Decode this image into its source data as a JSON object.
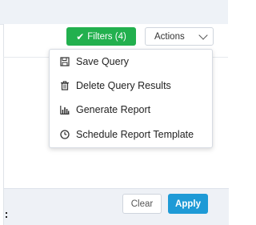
{
  "toolbar": {
    "filters_label": "Filters (4)",
    "actions_label": "Actions"
  },
  "actions_menu": {
    "items": [
      {
        "label": "Save Query",
        "icon": "save-icon"
      },
      {
        "label": "Delete Query Results",
        "icon": "trash-icon"
      },
      {
        "label": "Generate Report",
        "icon": "bar-chart-icon"
      },
      {
        "label": "Schedule Report Template",
        "icon": "clock-icon"
      }
    ]
  },
  "footer": {
    "clear_label": "Clear",
    "apply_label": "Apply"
  },
  "colors": {
    "filters_green": "#22b04e",
    "apply_blue": "#1e9ad6"
  }
}
